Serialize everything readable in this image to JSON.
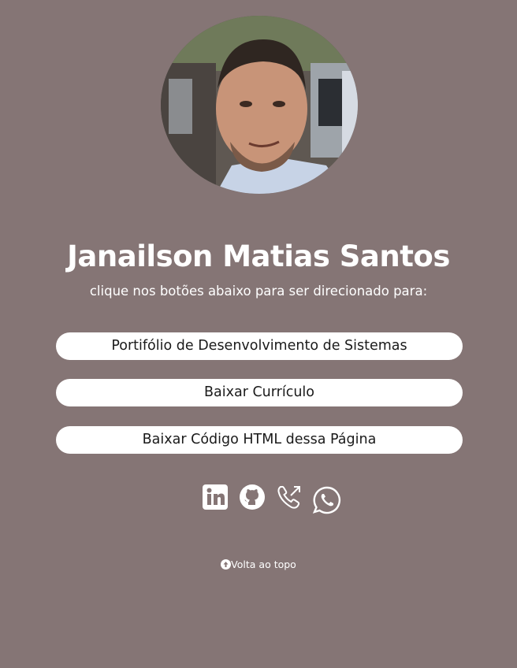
{
  "profile": {
    "photo_icon": "profile-photo",
    "name": "Janailson Matias Santos",
    "subtitle": "clique nos botões abaixo para ser direcionado para:"
  },
  "buttons": [
    {
      "label": "Portifólio de Desenvolvimento de Sistemas"
    },
    {
      "label": "Baixar Currículo"
    },
    {
      "label": "Baixar Código HTML dessa Página"
    }
  ],
  "social_icons": [
    "linkedin-icon",
    "github-icon",
    "phone-icon",
    "whatsapp-icon"
  ],
  "footer": {
    "back_to_top": "Volta ao topo",
    "back_to_top_icon": "arrow-up-circle-icon"
  },
  "colors": {
    "background": "#857575",
    "button_bg": "#ffffff",
    "button_text": "#1a1a1a",
    "text": "#ffffff"
  }
}
